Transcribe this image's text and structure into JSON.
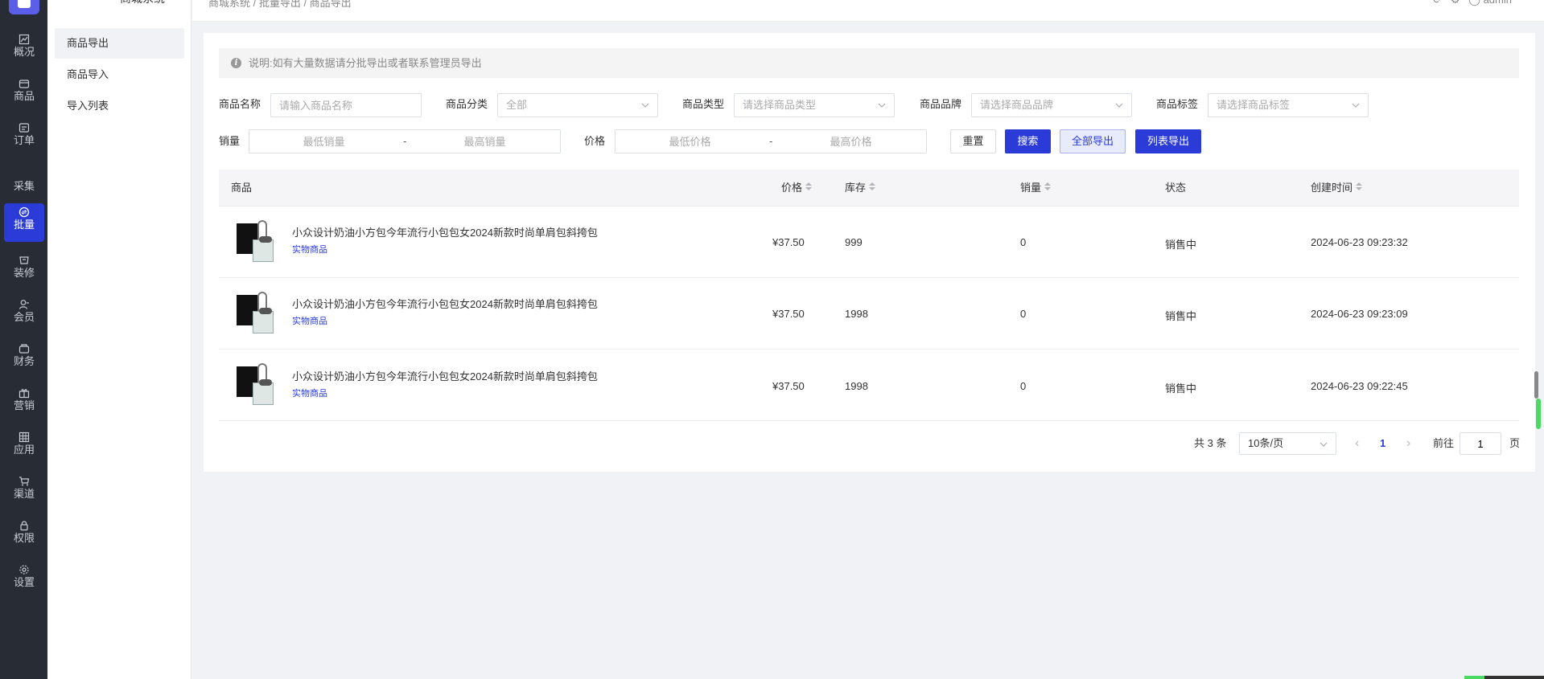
{
  "app": {
    "system_name": "商城系统"
  },
  "nav": [
    {
      "label": "概况",
      "icon": "chart-icon"
    },
    {
      "label": "商品",
      "icon": "box-icon"
    },
    {
      "label": "订单",
      "icon": "order-icon"
    },
    {
      "label": "采集",
      "icon": ""
    },
    {
      "label": "批量",
      "icon": "batch-icon"
    },
    {
      "label": "装修",
      "icon": "decorate-icon"
    },
    {
      "label": "会员",
      "icon": "user-icon"
    },
    {
      "label": "财务",
      "icon": "wallet-icon"
    },
    {
      "label": "营销",
      "icon": "gift-icon"
    },
    {
      "label": "应用",
      "icon": "grid-icon"
    },
    {
      "label": "渠道",
      "icon": "cart-icon"
    },
    {
      "label": "权限",
      "icon": "lock-icon"
    },
    {
      "label": "设置",
      "icon": "gear-icon"
    }
  ],
  "submenu": [
    {
      "label": "商品导出"
    },
    {
      "label": "商品导入"
    },
    {
      "label": "导入列表"
    }
  ],
  "topbar": {
    "breadcrumb": "商城系统 / 批量导出 / 商品导出",
    "user": "admin"
  },
  "notice": "说明:如有大量数据请分批导出或者联系管理员导出",
  "filters": {
    "name_label": "商品名称",
    "name_placeholder": "请输入商品名称",
    "category_label": "商品分类",
    "category_value": "全部",
    "type_label": "商品类型",
    "type_placeholder": "请选择商品类型",
    "brand_label": "商品品牌",
    "brand_placeholder": "请选择商品品牌",
    "tag_label": "商品标签",
    "tag_placeholder": "请选择商品标签",
    "sales_label": "销量",
    "sales_min_placeholder": "最低销量",
    "sales_max_placeholder": "最高销量",
    "price_label": "价格",
    "price_min_placeholder": "最低价格",
    "price_max_placeholder": "最高价格",
    "dash": "-"
  },
  "buttons": {
    "reset": "重置",
    "search": "搜索",
    "export_all": "全部导出",
    "export_list": "列表导出"
  },
  "table": {
    "headers": {
      "product": "商品",
      "price": "价格",
      "stock": "库存",
      "sales": "销量",
      "status": "状态",
      "created": "创建时间"
    },
    "rows": [
      {
        "name": "小众设计奶油小方包今年流行小包包女2024新款时尚单肩包斜挎包",
        "tag": "实物商品",
        "price": "¥37.50",
        "stock": "999",
        "sales": "0",
        "status": "销售中",
        "created": "2024-06-23 09:23:32"
      },
      {
        "name": "小众设计奶油小方包今年流行小包包女2024新款时尚单肩包斜挎包",
        "tag": "实物商品",
        "price": "¥37.50",
        "stock": "1998",
        "sales": "0",
        "status": "销售中",
        "created": "2024-06-23 09:23:09"
      },
      {
        "name": "小众设计奶油小方包今年流行小包包女2024新款时尚单肩包斜挎包",
        "tag": "实物商品",
        "price": "¥37.50",
        "stock": "1998",
        "sales": "0",
        "status": "销售中",
        "created": "2024-06-23 09:22:45"
      }
    ]
  },
  "pagination": {
    "total": "共 3 条",
    "page_size": "10条/页",
    "current": "1",
    "goto_label": "前往",
    "goto_value": "1",
    "page_suffix": "页",
    "prev": "‹",
    "next": "›"
  },
  "colors": {
    "primary": "#2a3bd8",
    "sidebar": "#282c34"
  }
}
